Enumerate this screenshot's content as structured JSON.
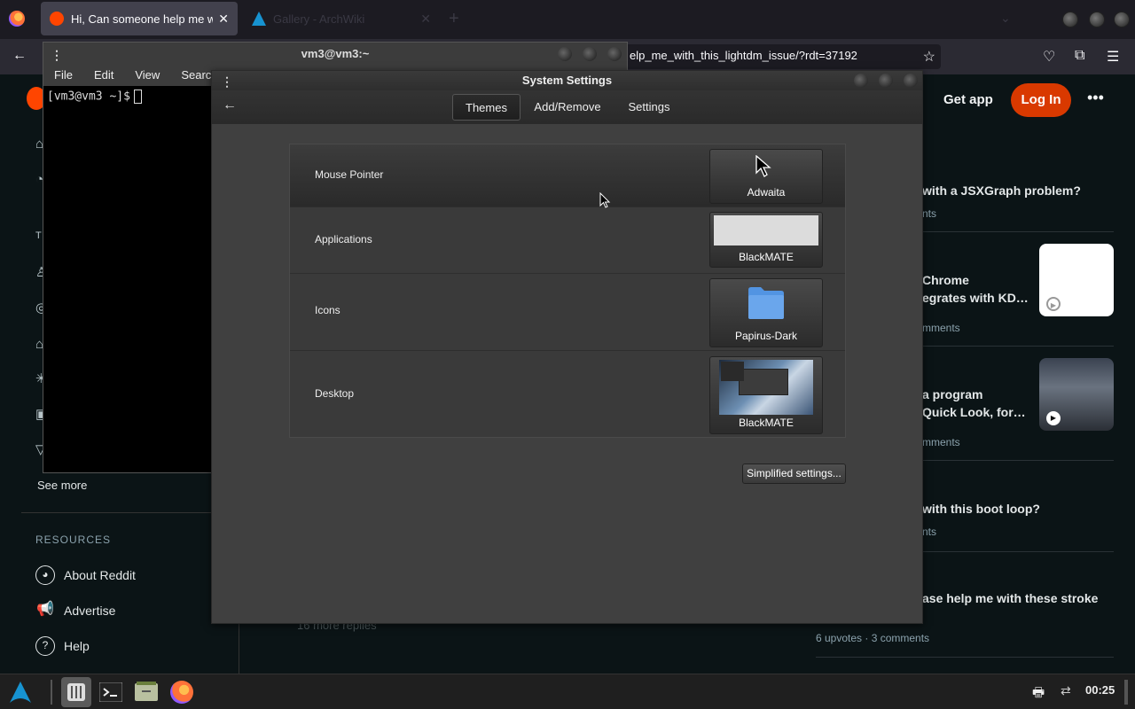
{
  "browser": {
    "tabs": [
      {
        "label": "Hi, Can someone help me with",
        "active": true
      },
      {
        "label": "Gallery - ArchWiki",
        "active": false
      }
    ],
    "url": "elp_me_with_this_lightdm_issue/?rdt=37192"
  },
  "reddit": {
    "get_app": "Get app",
    "login": "Log In",
    "see_more": "See more",
    "resources_heading": "RESOURCES",
    "resources": [
      {
        "label": "About Reddit",
        "icon": "reddit-logo-icon"
      },
      {
        "label": "Advertise",
        "icon": "megaphone-icon"
      },
      {
        "label": "Help",
        "icon": "help-icon"
      }
    ],
    "more_replies": "16 more replies",
    "feed": [
      {
        "title": "with a JSXGraph problem?",
        "meta": "nts"
      },
      {
        "title": "Chrome\negrates with KD…",
        "meta": "mments"
      },
      {
        "title": "a program\nQuick Look, for…",
        "meta": "mments"
      },
      {
        "title": "with this boot loop?",
        "meta": "nts"
      },
      {
        "title": "ase help me with these stroke",
        "meta": "6 upvotes · 3 comments"
      }
    ]
  },
  "terminal": {
    "title": "vm3@vm3:~",
    "menu": [
      "File",
      "Edit",
      "View",
      "Search"
    ],
    "prompt": "[vm3@vm3 ~]$"
  },
  "settings": {
    "title": "System Settings",
    "tabs": [
      "Themes",
      "Add/Remove",
      "Settings"
    ],
    "selected_tab": "Themes",
    "rows": [
      {
        "label": "Mouse Pointer",
        "value": "Adwaita"
      },
      {
        "label": "Applications",
        "value": "BlackMATE"
      },
      {
        "label": "Icons",
        "value": "Papirus-Dark"
      },
      {
        "label": "Desktop",
        "value": "BlackMATE"
      }
    ],
    "simplified_button": "Simplified settings..."
  },
  "taskbar": {
    "clock": "00:25"
  }
}
